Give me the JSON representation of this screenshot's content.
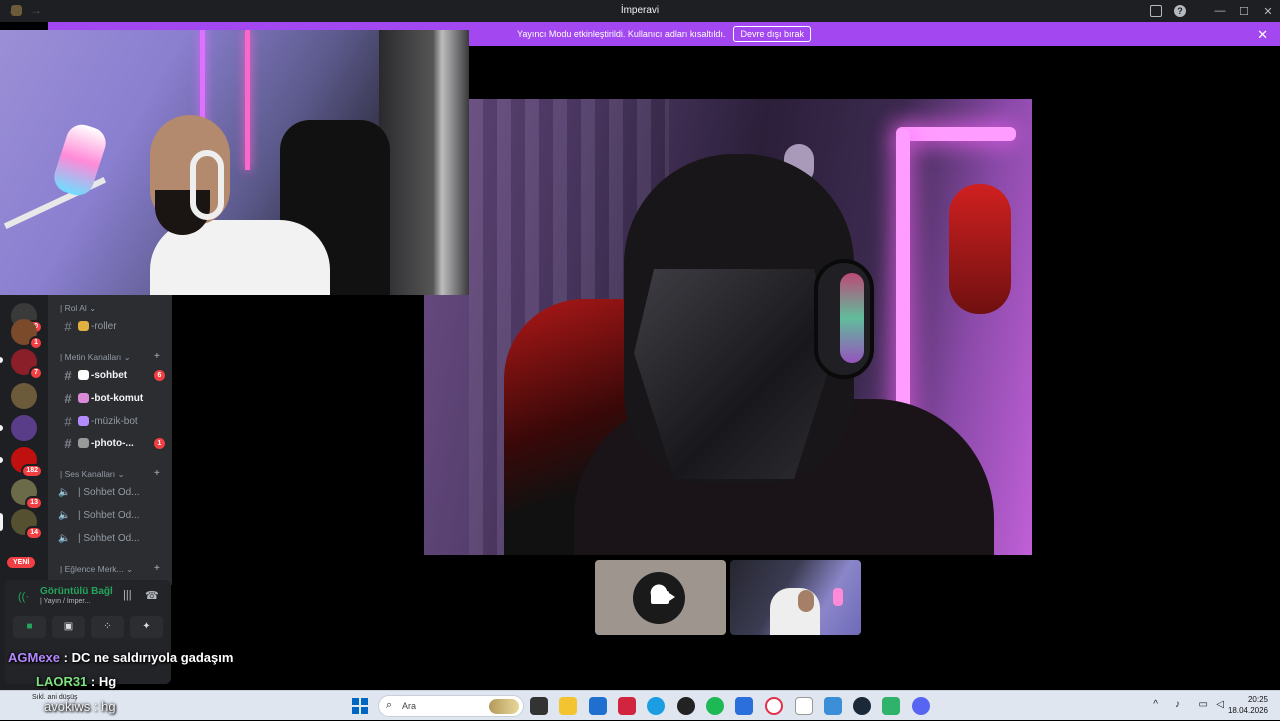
{
  "window": {
    "title": "İmperavi",
    "back_icon": "arrow-left-icon",
    "forward_icon": "arrow-right-icon"
  },
  "streamer_bar": {
    "message": "Yayıncı Modu etkinleştirildi. Kullanıcı adları kısaltıldı.",
    "button_label": "Devre dışı bırak",
    "color": "#a348f0"
  },
  "servers": [
    {
      "badge": "70",
      "color": "#3a3a3a"
    },
    {
      "badge": "1",
      "color": "#7a4a2a"
    },
    {
      "badge": "7",
      "color": "#8a1f2a"
    },
    {
      "badge": "",
      "color": "#6b5b3a"
    },
    {
      "badge": "",
      "color": "#5a3d88"
    },
    {
      "badge": "182",
      "color": "#c01010"
    },
    {
      "badge": "13",
      "color": "#6b6b4a"
    },
    {
      "badge": "14",
      "color": "#55502f"
    },
    {
      "badge": "YENİ",
      "color": "#888"
    }
  ],
  "channels": {
    "categories": [
      {
        "label": "| Rol Al",
        "collapsed_icon": "chevron-down-icon"
      },
      {
        "label": "| Metin Kanalları",
        "collapsed_icon": "chevron-down-icon"
      },
      {
        "label": "| Ses Kanalları",
        "collapsed_icon": "chevron-down-icon"
      },
      {
        "label": "| Eğlence Merk...",
        "collapsed_icon": "chevron-down-icon"
      }
    ],
    "text": [
      {
        "name": "-roller",
        "unread": false,
        "mentions": ""
      },
      {
        "name": "-sohbet",
        "unread": true,
        "mentions": "6"
      },
      {
        "name": "-bot-komut",
        "unread": true,
        "mentions": ""
      },
      {
        "name": "-müzik-bot",
        "unread": false,
        "mentions": ""
      },
      {
        "name": "-photo-...",
        "unread": true,
        "mentions": "1"
      }
    ],
    "voice": [
      {
        "name": "| Sohbet Od..."
      },
      {
        "name": "| Sohbet Od..."
      },
      {
        "name": "| Sohbet Od..."
      }
    ]
  },
  "voice_panel": {
    "status": "Görüntülü Bağl",
    "channel": "| Yayın / İmper...",
    "status_color": "#23a55a"
  },
  "chat": [
    {
      "user": "AGMexe",
      "text": ": DC ne saldırıyola gadaşım"
    },
    {
      "user": "LAOR31",
      "text": ": Hg"
    },
    {
      "user": "avokiws",
      "text": ": hg"
    }
  ],
  "taskbar": {
    "weather": "Sıkl. ani düşüş",
    "search_placeholder": "Ara",
    "time": "20:25",
    "date": "18.04.2026"
  }
}
